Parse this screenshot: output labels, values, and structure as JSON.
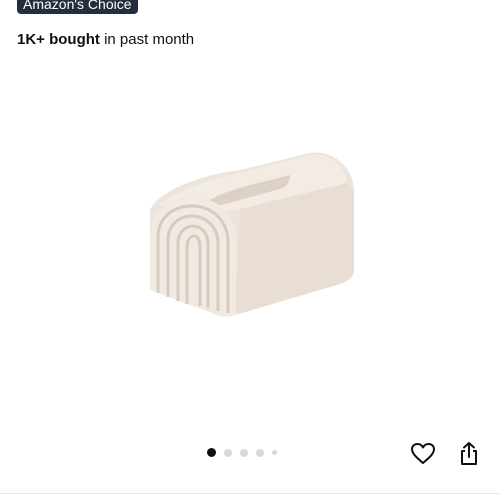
{
  "badge": {
    "label": "Amazon's Choice"
  },
  "social_proof": {
    "count": "1K+ bought",
    "suffix": " in past month"
  },
  "image_carousel": {
    "product_image": "arched-ceramic-tissue-box",
    "total_images": 5,
    "current_index": 1
  },
  "actions": {
    "favorite_icon": "heart-outline-icon",
    "share_icon": "share-icon"
  },
  "colors": {
    "badge_bg": "#232f3e",
    "text": "#0f1111",
    "dot_active": "#0f1111",
    "dot_inactive": "#d5d9d9",
    "product": "#ece3da"
  }
}
